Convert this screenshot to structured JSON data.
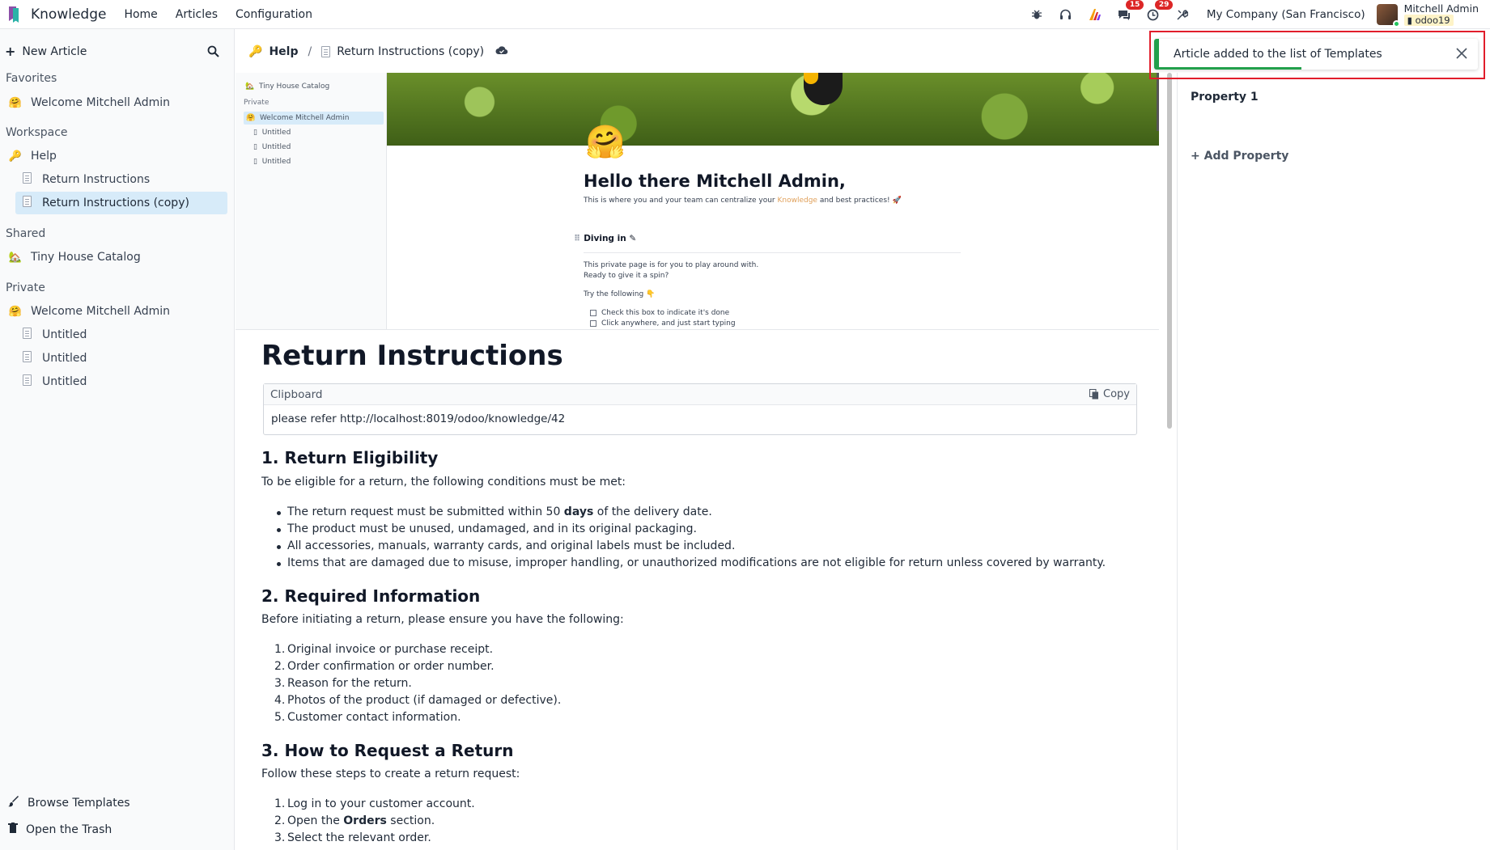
{
  "navbar": {
    "app_name": "Knowledge",
    "menu": [
      "Home",
      "Articles",
      "Configuration"
    ],
    "messages_count": "15",
    "activities_count": "29",
    "company": "My Company (San Francisco)",
    "user_name": "Mitchell Admin",
    "database": "odoo19"
  },
  "sidebar": {
    "new_article": "New Article",
    "favorites_title": "Favorites",
    "favorites": [
      {
        "emoji": "🤗",
        "label": "Welcome Mitchell Admin"
      }
    ],
    "workspace_title": "Workspace",
    "workspace": [
      {
        "emoji": "🔑",
        "label": "Help"
      },
      {
        "label": "Return Instructions"
      },
      {
        "label": "Return Instructions (copy)"
      }
    ],
    "shared_title": "Shared",
    "shared": [
      {
        "emoji": "🏡",
        "label": "Tiny House Catalog"
      }
    ],
    "private_title": "Private",
    "private": [
      {
        "emoji": "🤗",
        "label": "Welcome Mitchell Admin"
      },
      {
        "label": "Untitled"
      },
      {
        "label": "Untitled"
      },
      {
        "label": "Untitled"
      }
    ],
    "browse_templates": "Browse Templates",
    "open_trash": "Open the Trash"
  },
  "breadcrumb": {
    "parent_emoji": "🔑",
    "parent": "Help",
    "current": "Return Instructions (copy)"
  },
  "preview": {
    "side_shared": "Tiny House Catalog",
    "side_private_title": "Private",
    "side_active": "Welcome Mitchell Admin",
    "side_items": [
      "Untitled",
      "Untitled",
      "Untitled"
    ],
    "emoji": "🤗",
    "title": "Hello there Mitchell Admin,",
    "subtitle_before": "This is where you and your team can centralize your ",
    "subtitle_link": "Knowledge",
    "subtitle_after": " and best practices! 🚀",
    "heading": "Diving in ✎",
    "line1": "This private page is for you to play around with.",
    "line2": "Ready to give it a spin?",
    "line3": "Try the following 👇",
    "check1": "Check this box to indicate it's done",
    "check2": "Click anywhere, and just start typing"
  },
  "article": {
    "title": "Return Instructions",
    "clipboard_label": "Clipboard",
    "copy_label": "Copy",
    "clipboard_text": "please refer http://localhost:8019/odoo/knowledge/42",
    "s1_title": "1. Return Eligibility",
    "s1_intro": "To be eligible for a return, the following conditions must be met:",
    "s1_b1_pre": "The return request must be submitted within 50 ",
    "s1_b1_bold": "days",
    "s1_b1_post": " of the delivery date.",
    "s1_b2": "The product must be unused, undamaged, and in its original packaging.",
    "s1_b3": "All accessories, manuals, warranty cards, and original labels must be included.",
    "s1_b4": "Items that are damaged due to misuse, improper handling, or unauthorized modifications are not eligible for return unless covered by warranty.",
    "s2_title": "2. Required Information",
    "s2_intro": "Before initiating a return, please ensure you have the following:",
    "s2_items": [
      "Original invoice or purchase receipt.",
      "Order confirmation or order number.",
      "Reason for the return.",
      "Photos of the product (if damaged or defective).",
      "Customer contact information."
    ],
    "s3_title": "3. How to Request a Return",
    "s3_intro": "Follow these steps to create a return request:",
    "s3_i1": "Log in to your customer account.",
    "s3_i2_pre": "Open the ",
    "s3_i2_bold": "Orders",
    "s3_i2_post": " section.",
    "s3_i3": "Select the relevant order."
  },
  "properties": {
    "property_label": "Property 1",
    "add_property": "Add Property"
  },
  "toast": {
    "message": "Article added to the list of Templates"
  }
}
